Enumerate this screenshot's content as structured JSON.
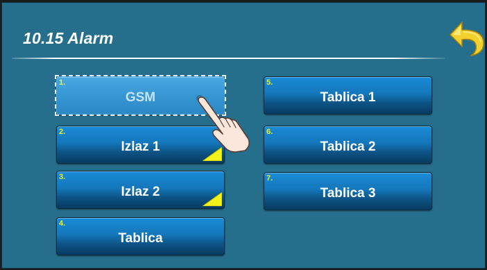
{
  "screen": {
    "title": "10.15 Alarm",
    "back_icon": "back-arrow-icon"
  },
  "colors": {
    "background": "#266f8c",
    "button_top": "#1a8bd6",
    "button_bottom": "#083a5f",
    "number_yellow": "#f2f21d",
    "back_arrow": "#f2d12f"
  },
  "buttons": [
    {
      "num": "1.",
      "label": "GSM",
      "state": "selected"
    },
    {
      "num": "2.",
      "label": "Izlaz 1",
      "has_corner_marker": true
    },
    {
      "num": "3.",
      "label": "Izlaz 2",
      "has_corner_marker": true
    },
    {
      "num": "4.",
      "label": "Tablica"
    },
    {
      "num": "5.",
      "label": "Tablica 1"
    },
    {
      "num": "6.",
      "label": "Tablica 2"
    },
    {
      "num": "7.",
      "label": "Tablica 3"
    }
  ],
  "cursor_icon": "pointing-hand-icon"
}
